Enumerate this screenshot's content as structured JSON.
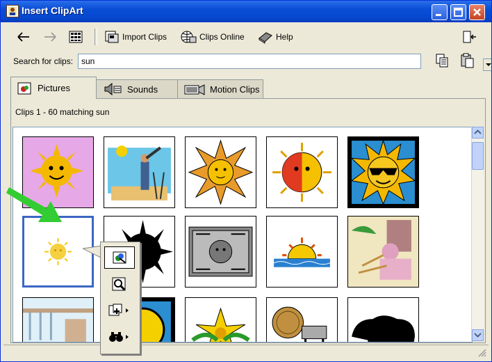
{
  "window": {
    "title": "Insert ClipArt"
  },
  "toolbar": {
    "back_icon": "back-arrow-icon",
    "forward_icon": "forward-arrow-icon",
    "import_label": "Import Clips",
    "online_label": "Clips Online",
    "help_label": "Help"
  },
  "search": {
    "label": "Search for clips:",
    "value": "sun"
  },
  "tabs": [
    {
      "label": "Pictures",
      "active": true
    },
    {
      "label": "Sounds",
      "active": false
    },
    {
      "label": "Motion Clips",
      "active": false
    }
  ],
  "status": "Clips 1 - 60 matching sun",
  "clips": [
    "smiling-sun-pink",
    "man-with-telescope",
    "aztec-sun",
    "sun-face-half-red",
    "sun-with-sunglasses",
    "small-sun-selected",
    "sun-eclipse-silhouette",
    "stone-tablet",
    "sunset-over-water",
    "beach-scene",
    "beach-window",
    "sun-corner",
    "yellow-flower",
    "coin-and-cow",
    "black-bear"
  ],
  "popup": [
    "insert-clip",
    "preview-clip",
    "add-to-favorites",
    "find-similar"
  ],
  "colors": {
    "titlebar": "#0A4ED6",
    "selection": "#3b66c3",
    "arrow": "#33cc33"
  }
}
